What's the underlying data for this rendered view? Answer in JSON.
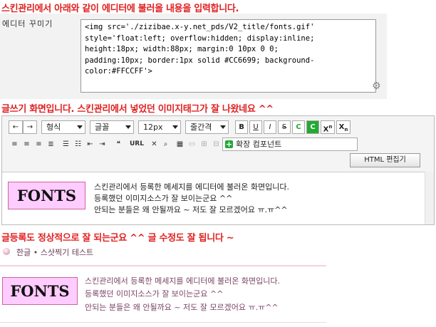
{
  "section1": {
    "heading": "스킨관리에서 아래와 같이 에디터에 불러올 내용을 입력합니다.",
    "field_label": "에디터 꾸미기",
    "code_lines": [
      "<img src='./zizibae.x-y.net_pds/V2_title/fonts.gif'",
      "style='float:left; overflow:hidden; display:inline;",
      "height:18px; width:88px; margin:0 10px 0 0;",
      "padding:10px; border:1px solid #CC6699; background-",
      "color:#FFCCFF'>"
    ]
  },
  "section2": {
    "heading": "글쓰기 화면입니다. 스킨관리에서 넣었던 이미지태그가 잘 나왔네요 ^^",
    "toolbar": {
      "undo": "←",
      "redo": "→",
      "format_select": "형식",
      "font_select": "글꼴",
      "size_select": "12px",
      "line_spacing_select": "줄간격",
      "bold": "B",
      "underline": "U",
      "italic": "I",
      "strike": "S",
      "font_color": "C",
      "bg_color": "C",
      "superscript": "X",
      "superscript_mark": "n",
      "subscript": "X",
      "subscript_mark": "n",
      "url": "URL",
      "extension_button": "확장 컴포넌트",
      "html_button": "HTML 편집기"
    },
    "logo_text": "FONTS",
    "body_lines": [
      "스킨관리에서 등록한 메세지를 에디터에 불러온 화면입니다.",
      "등록했던 이미지소스가 잘 보이는군요 ^^",
      "안되는 분들은 왜 안될까요 ~ 저도 잘 모르겠어요 ㅠ.ㅠ^^"
    ]
  },
  "section3": {
    "heading": "글등록도 정상적으로 잘 되는군요 ^^ 글 수정도 잘 됩니다 ~",
    "crumb": "한글 • 스샷찍기 테스트",
    "logo_text": "FONTS",
    "body_lines": [
      "스킨관리에서 등록한 메세지를 에디터에 불러온 화면입니다.",
      "등록했던 이미지소스가 잘 보이는군요 ^^",
      "안되는 분들은 왜 안될까요 ~ 저도 잘 모르겠어요 ㅠ.ㅠ^^"
    ]
  },
  "colors": {
    "heading": "#e02020",
    "logo_bg": "#ffccff",
    "logo_border": "#cc6699",
    "green_button": "#22aa33"
  }
}
